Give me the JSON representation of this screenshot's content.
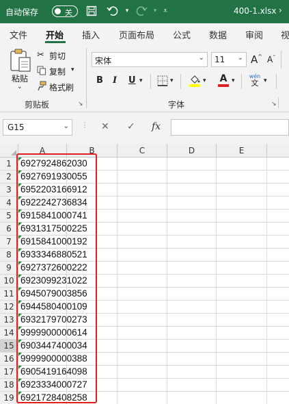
{
  "titlebar": {
    "autosave_label": "自动保存",
    "autosave_state": "关",
    "filename": "400-1.xlsx",
    "icons": [
      "save-icon",
      "undo-icon",
      "redo-icon",
      "customize-icon"
    ]
  },
  "tabs": [
    "文件",
    "开始",
    "插入",
    "页面布局",
    "公式",
    "数据",
    "审阅",
    "视"
  ],
  "active_tab": "开始",
  "ribbon": {
    "clipboard": {
      "paste": "粘贴",
      "cut": "剪切",
      "copy": "复制",
      "format_painter": "格式刷",
      "group_label": "剪贴板"
    },
    "font": {
      "font_name": "宋体",
      "font_size": "11",
      "grow": "A",
      "shrink": "A",
      "bold": "B",
      "italic": "I",
      "underline": "U",
      "font_color_letter": "A",
      "phonetic_top": "wén",
      "phonetic_bottom": "文",
      "group_label": "字体",
      "fill_color": "#ffff00",
      "font_color": "#e02020"
    }
  },
  "formula_bar": {
    "name_box": "G15",
    "fx": "fx",
    "cancel": "✕",
    "enter": "✓"
  },
  "sheet": {
    "columns": [
      "A",
      "B",
      "C",
      "D",
      "E"
    ],
    "rows": [
      {
        "num": "1",
        "a": "6927924862030"
      },
      {
        "num": "2",
        "a": "6927691930055"
      },
      {
        "num": "3",
        "a": "6952203166912"
      },
      {
        "num": "4",
        "a": "6922242736834"
      },
      {
        "num": "5",
        "a": "6915841000741"
      },
      {
        "num": "6",
        "a": "6931317500225"
      },
      {
        "num": "7",
        "a": "6915841000192"
      },
      {
        "num": "8",
        "a": "6933346880521"
      },
      {
        "num": "9",
        "a": "6927372600222"
      },
      {
        "num": "10",
        "a": "6923099231022"
      },
      {
        "num": "11",
        "a": "6945079003856"
      },
      {
        "num": "12",
        "a": "6944580400109"
      },
      {
        "num": "13",
        "a": "6932179700273"
      },
      {
        "num": "14",
        "a": "9999900000614"
      },
      {
        "num": "15",
        "a": "6903447400034"
      },
      {
        "num": "16",
        "a": "9999900000388"
      },
      {
        "num": "17",
        "a": "6905419164098"
      },
      {
        "num": "18",
        "a": "6923334000727"
      },
      {
        "num": "19",
        "a": "6921728408258"
      }
    ],
    "selected_row": "15",
    "highlight_color": "#e02020"
  }
}
